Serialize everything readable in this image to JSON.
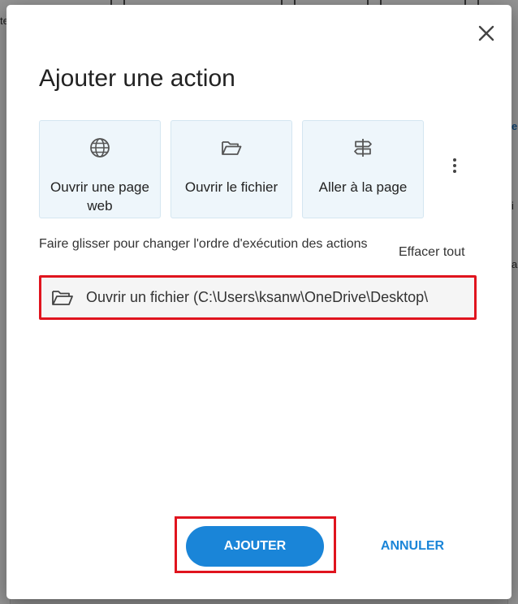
{
  "dialog": {
    "title": "Ajouter une action",
    "close_icon": "close-icon",
    "tiles": [
      {
        "label": "Ouvrir une page web",
        "icon": "globe-icon"
      },
      {
        "label": "Ouvrir le fichier",
        "icon": "folder-open-icon"
      },
      {
        "label": "Aller à la page",
        "icon": "signpost-icon"
      }
    ],
    "more_icon": "more-vertical-icon",
    "instructions": "Faire glisser pour changer l'ordre d'exécution des actions",
    "clear_all_label": "Effacer tout",
    "actions": [
      {
        "label": "Ouvrir un fichier (C:\\Users\\ksanw\\OneDrive\\Desktop\\",
        "icon": "folder-open-icon"
      }
    ],
    "add_label": "AJOUTER",
    "cancel_label": "ANNULER"
  },
  "colors": {
    "accent": "#1a85d8",
    "highlight_outline": "#e0141e",
    "tile_background": "#eef6fb"
  }
}
